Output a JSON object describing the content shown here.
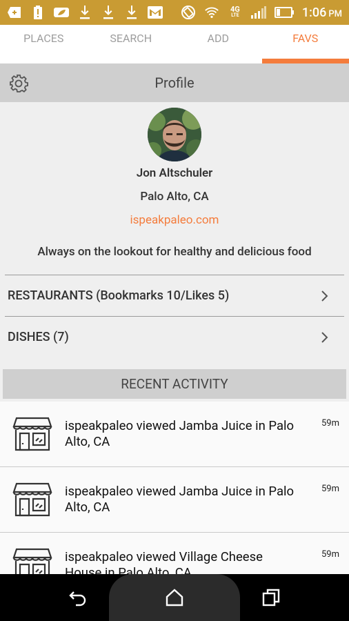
{
  "status_bar": {
    "time": "1:06",
    "ampm": "PM",
    "network": "4G",
    "network_sub": "LTE"
  },
  "tabs": [
    {
      "label": "PLACES",
      "active": false
    },
    {
      "label": "SEARCH",
      "active": false
    },
    {
      "label": "ADD",
      "active": false
    },
    {
      "label": "FAVS",
      "active": true
    }
  ],
  "profile": {
    "header_title": "Profile",
    "name": "Jon Altschuler",
    "location": "Palo Alto, CA",
    "website": "ispeakpaleo.com",
    "bio": "Always on the lookout for healthy and delicious food"
  },
  "menu": {
    "restaurants": "RESTAURANTS (Bookmarks 10/Likes 5)",
    "dishes": "DISHES (7)"
  },
  "recent_activity": {
    "title": "RECENT ACTIVITY",
    "items": [
      {
        "text": "ispeakpaleo viewed Jamba Juice in Palo Alto, CA",
        "time": "59m"
      },
      {
        "text": "ispeakpaleo viewed Jamba Juice in Palo Alto, CA",
        "time": "59m"
      },
      {
        "text": "ispeakpaleo viewed Village Cheese House in Palo Alto, CA",
        "time": "59m"
      }
    ]
  },
  "colors": {
    "accent": "#f47c3c",
    "status_bar": "#c99b33",
    "section_header": "#cfcfcf"
  }
}
